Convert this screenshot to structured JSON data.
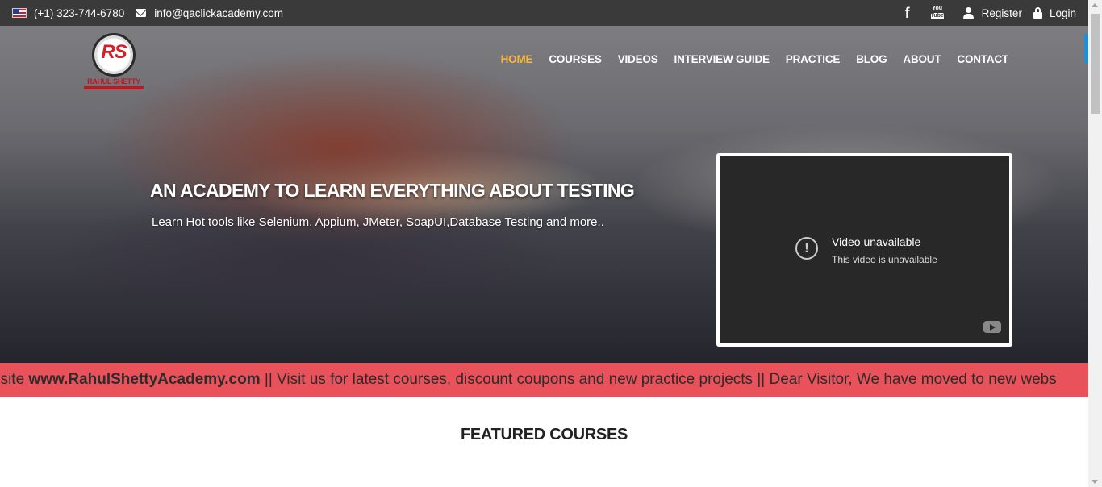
{
  "topbar": {
    "phone": "(+1) 323-744-6780",
    "email": "info@qaclickacademy.com",
    "facebook_glyph": "f",
    "youtube_you": "You",
    "youtube_tube": "Tube",
    "register": "Register",
    "login": "Login"
  },
  "logo": {
    "monogram": "RS",
    "name": "RAHUL SHETTY"
  },
  "nav": {
    "home": "HOME",
    "courses": "COURSES",
    "videos": "VIDEOS",
    "interview_guide": "INTERVIEW GUIDE",
    "practice": "PRACTICE",
    "blog": "BLOG",
    "about": "ABOUT",
    "contact": "CONTACT",
    "active_color": "#f6b63d"
  },
  "hero": {
    "title": "AN ACADEMY TO LEARN EVERYTHING ABOUT TESTING",
    "subtitle": "Learn Hot tools like Selenium, Appium, JMeter, SoapUI,Database Testing and more.."
  },
  "video": {
    "alert_glyph": "!",
    "title": "Video unavailable",
    "message": "This video is unavailable"
  },
  "marquee": {
    "prefix": "bsite ",
    "link": "www.RahulShettyAcademy.com",
    "rest": " || Visit us for latest courses, discount coupons and new practice projects || Dear Visitor, We have moved to new webs",
    "bg_color": "#e9525a"
  },
  "featured": {
    "heading": "FEATURED COURSES"
  }
}
